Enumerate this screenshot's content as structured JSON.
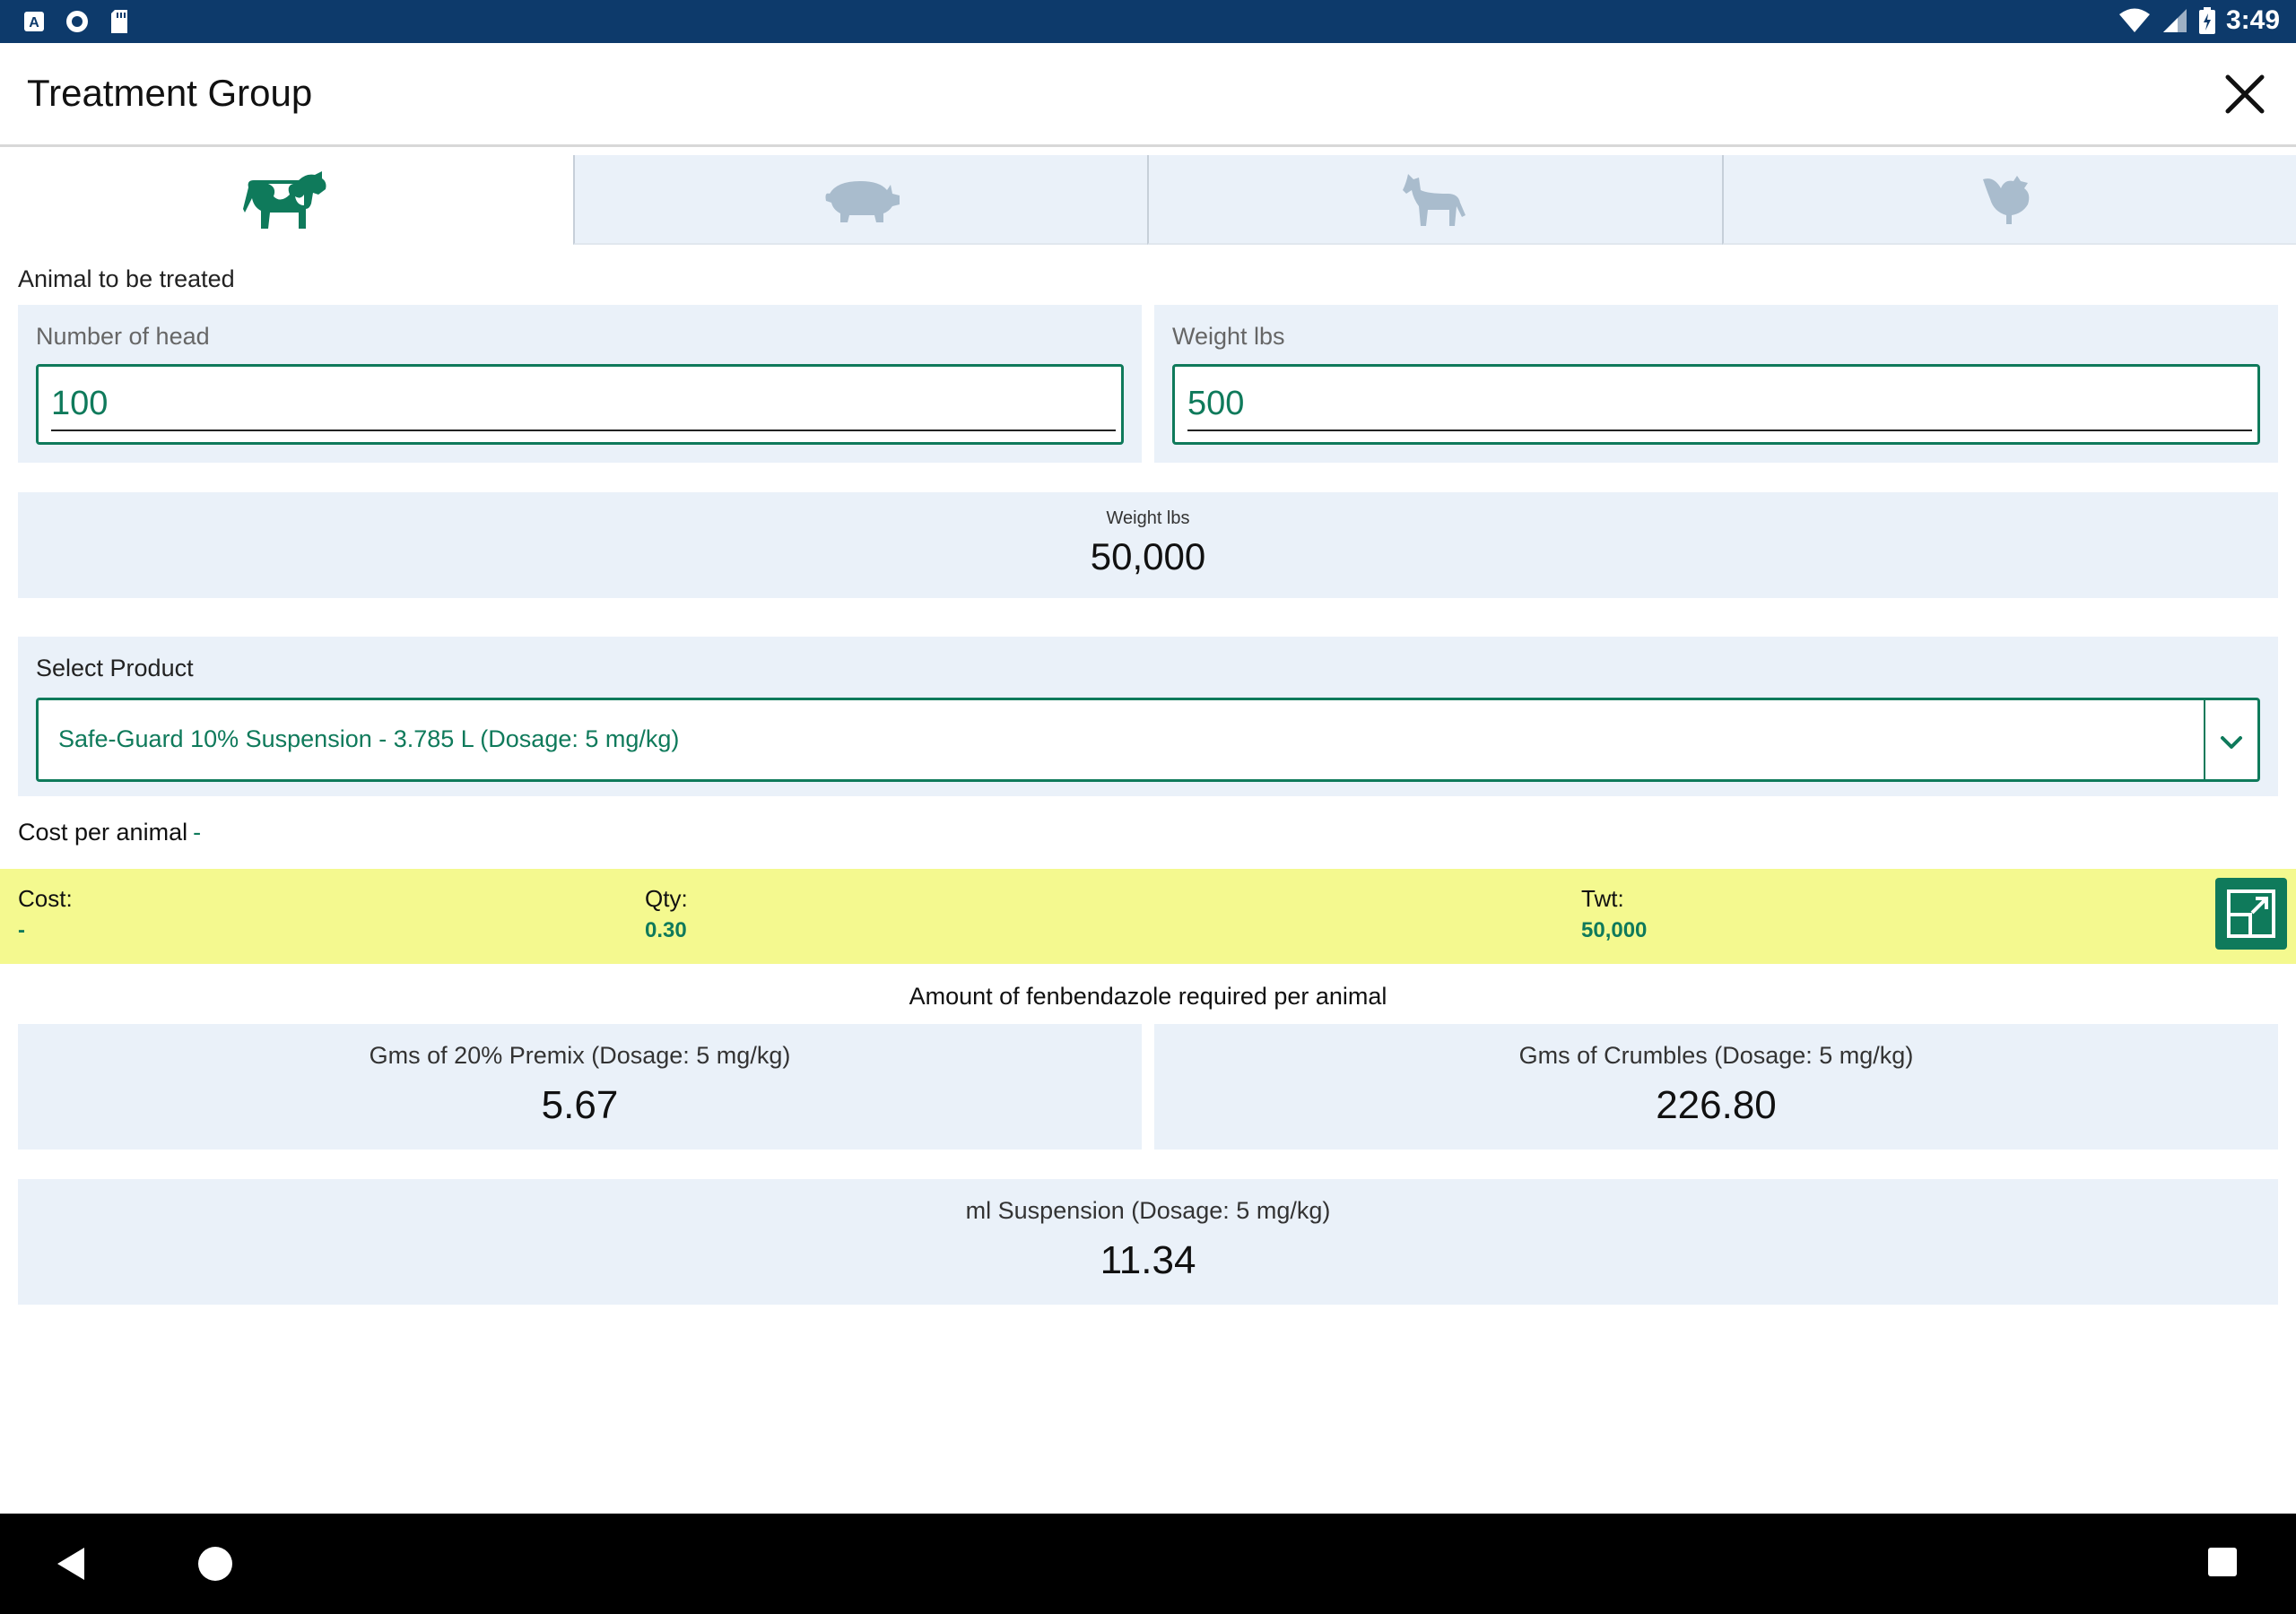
{
  "status_bar": {
    "time": "3:49",
    "left_icons": [
      "a-badge-icon",
      "circle-icon",
      "sd-card-icon"
    ],
    "right_icons": [
      "wifi-icon",
      "signal-icon",
      "battery-charging-icon"
    ]
  },
  "app_bar": {
    "title": "Treatment Group"
  },
  "tabs": [
    {
      "icon": "cow-icon",
      "active": true
    },
    {
      "icon": "pig-icon",
      "active": false
    },
    {
      "icon": "horse-icon",
      "active": false
    },
    {
      "icon": "chicken-icon",
      "active": false
    }
  ],
  "animal_section": {
    "label": "Animal to be treated",
    "head_label": "Number of head",
    "head_value": "100",
    "weight_label": "Weight lbs",
    "weight_value": "500"
  },
  "total": {
    "label": "Weight lbs",
    "value": "50,000"
  },
  "product": {
    "label": "Select Product",
    "selected": "Safe-Guard 10% Suspension - 3.785 L (Dosage: 5 mg/kg)"
  },
  "cost_per_animal": {
    "label": "Cost per animal",
    "value": "-"
  },
  "summary": {
    "cost_label": "Cost:",
    "cost_value": "-",
    "qty_label": "Qty:",
    "qty_value": "0.30",
    "twt_label": "Twt:",
    "twt_value": "50,000"
  },
  "amount": {
    "title": "Amount of fenbendazole required per animal",
    "premix_label": "Gms of 20% Premix (Dosage: 5 mg/kg)",
    "premix_value": "5.67",
    "crumbles_label": "Gms of Crumbles (Dosage: 5 mg/kg)",
    "crumbles_value": "226.80",
    "suspension_label": "ml Suspension (Dosage: 5 mg/kg)",
    "suspension_value": "11.34"
  },
  "colors": {
    "status_bar": "#0d3a6b",
    "accent": "#0f7a5b",
    "card_bg": "#eaf1f9",
    "summary_bg": "#f4f98f",
    "inactive_icon": "#a9bccd"
  }
}
